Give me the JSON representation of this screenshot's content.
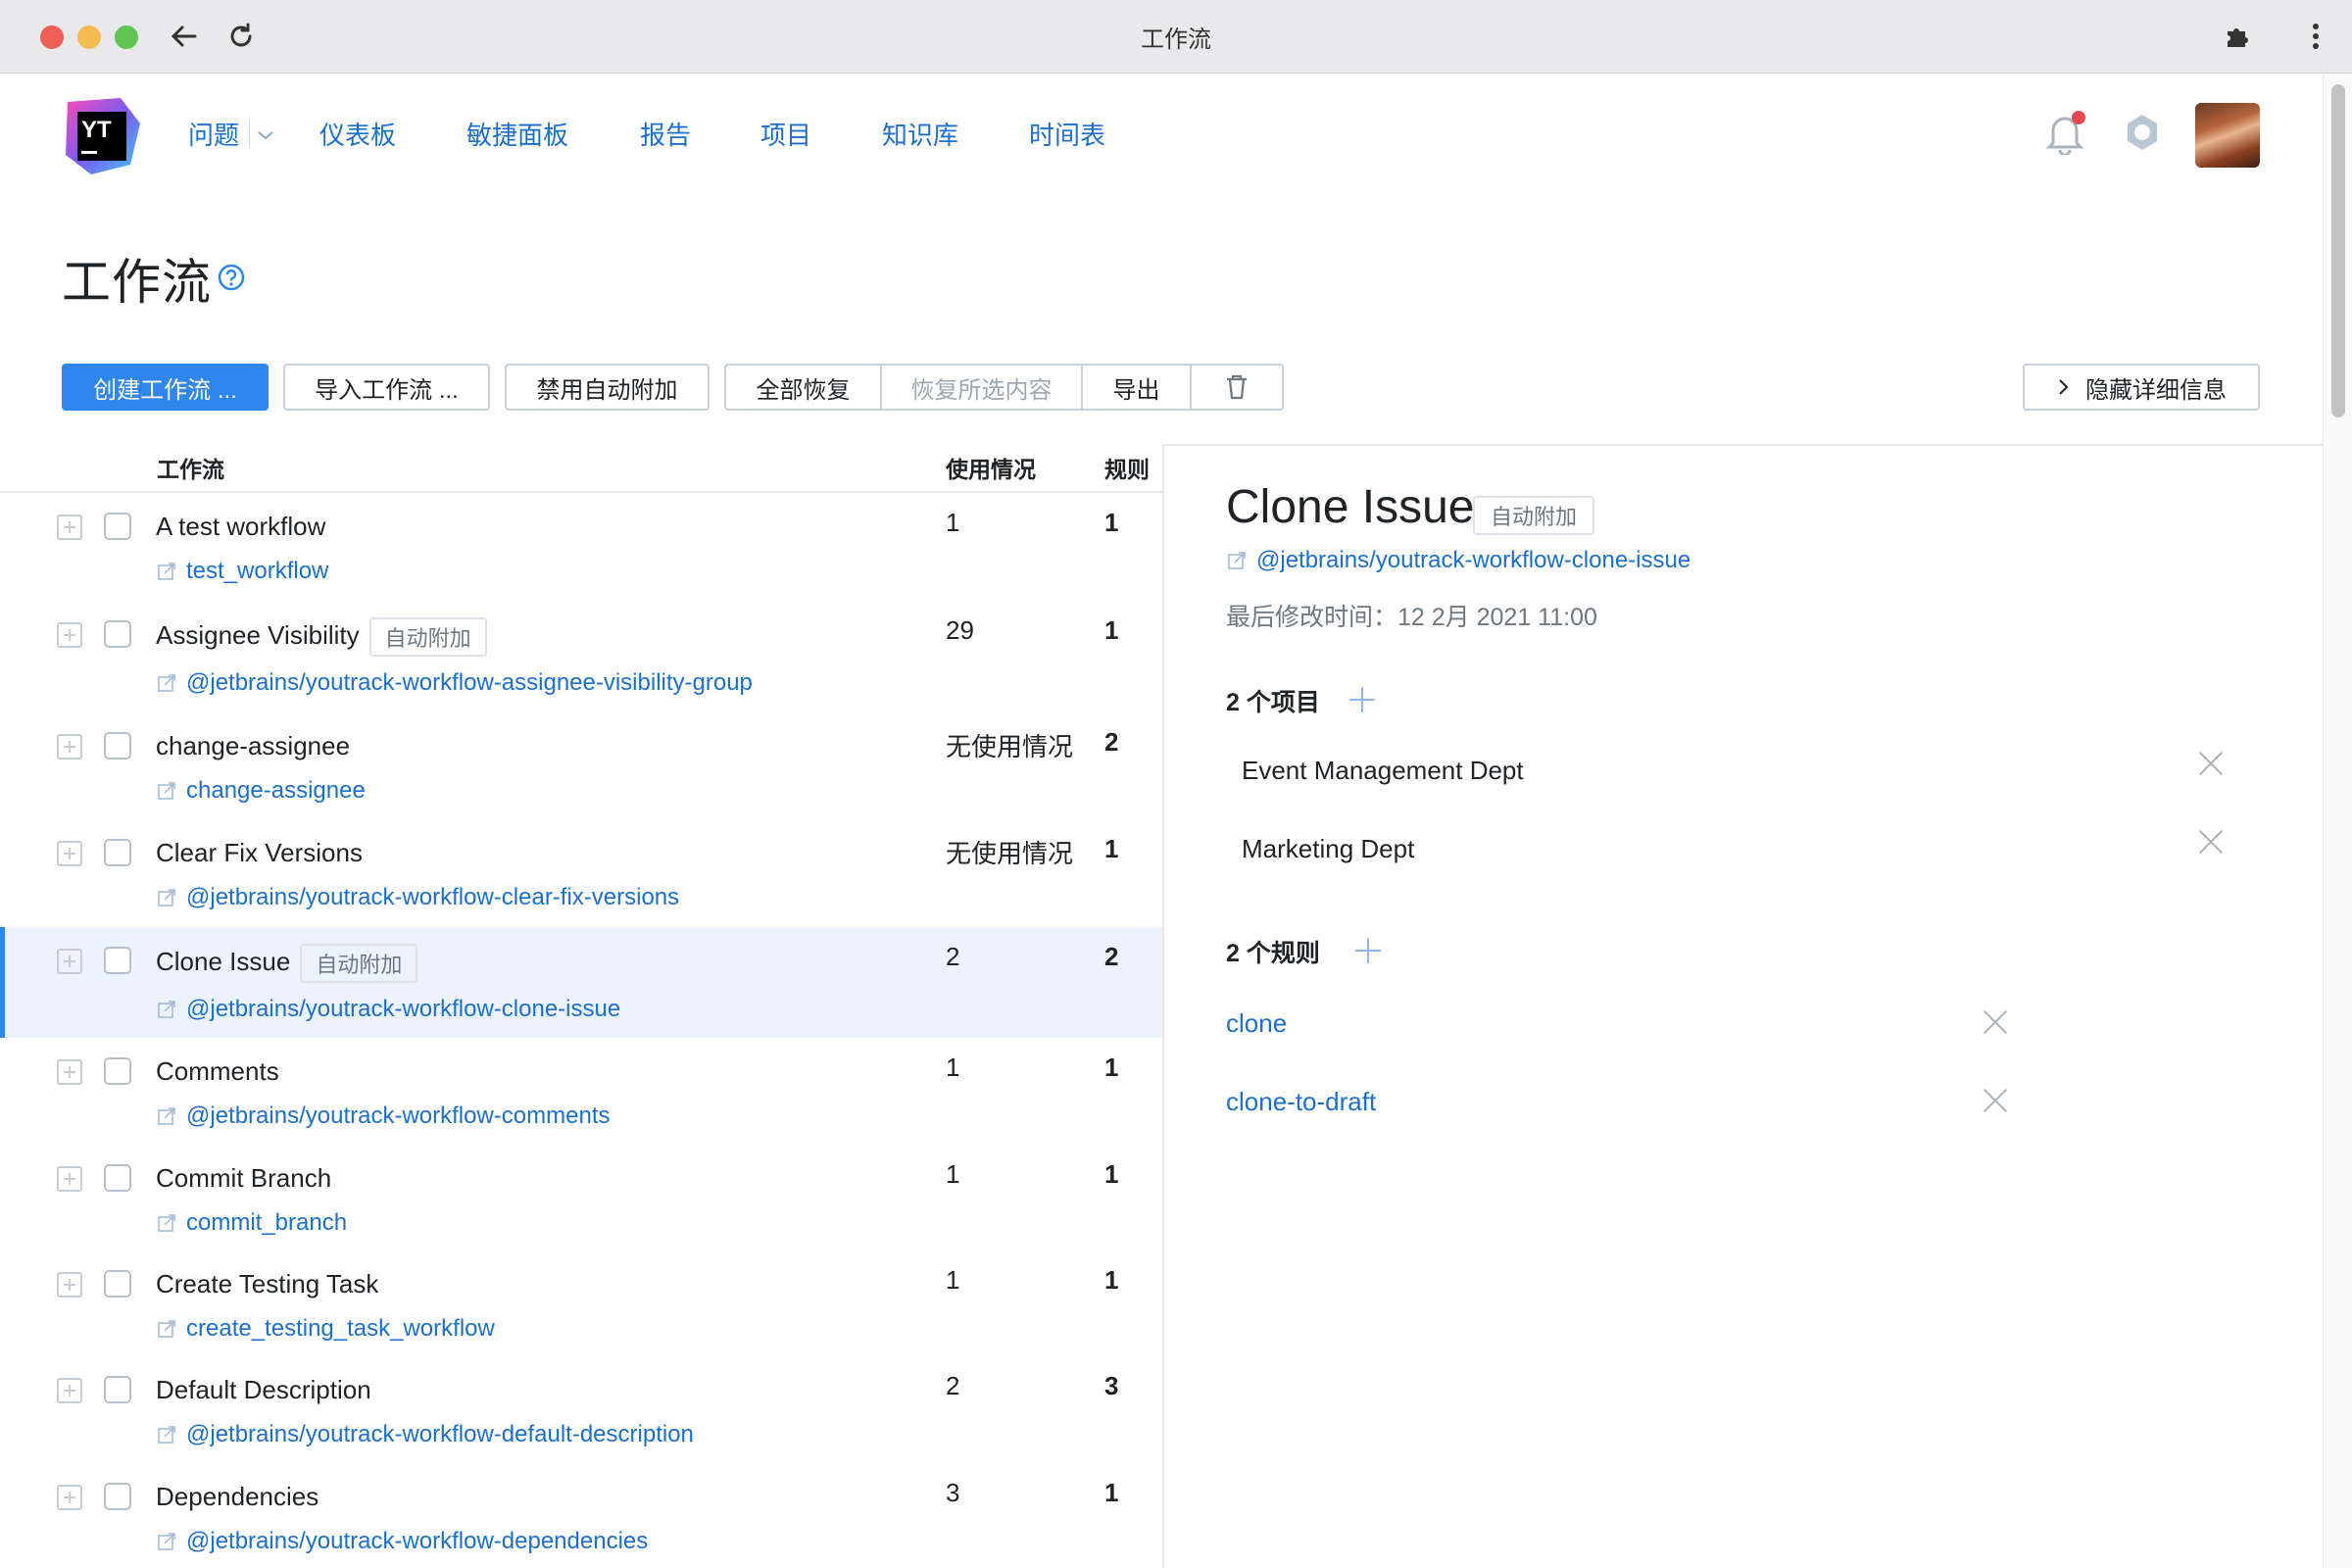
{
  "browser": {
    "title": "工作流"
  },
  "nav": {
    "items": [
      "问题",
      "仪表板",
      "敏捷面板",
      "报告",
      "项目",
      "知识库",
      "时间表"
    ],
    "logo_text": "YT"
  },
  "page": {
    "title": "工作流"
  },
  "toolbar": {
    "create": "创建工作流 ...",
    "import": "导入工作流 ...",
    "disable_autoattach": "禁用自动附加",
    "restore_all": "全部恢复",
    "restore_selected": "恢复所选内容",
    "export": "导出",
    "hide_details": "隐藏详细信息"
  },
  "list": {
    "headers": {
      "workflow": "工作流",
      "usage": "使用情况",
      "rules": "规则"
    },
    "rows": [
      {
        "name": "A test workflow",
        "tag": "",
        "package": "test_workflow",
        "usage": "1",
        "rules": "1"
      },
      {
        "name": "Assignee Visibility",
        "tag": "自动附加",
        "package": "@jetbrains/youtrack-workflow-assignee-visibility-group",
        "usage": "29",
        "rules": "1"
      },
      {
        "name": "change-assignee",
        "tag": "",
        "package": "change-assignee",
        "usage": "无使用情况",
        "rules": "2"
      },
      {
        "name": "Clear Fix Versions",
        "tag": "",
        "package": "@jetbrains/youtrack-workflow-clear-fix-versions",
        "usage": "无使用情况",
        "rules": "1"
      },
      {
        "name": "Clone Issue",
        "tag": "自动附加",
        "package": "@jetbrains/youtrack-workflow-clone-issue",
        "usage": "2",
        "rules": "2"
      },
      {
        "name": "Comments",
        "tag": "",
        "package": "@jetbrains/youtrack-workflow-comments",
        "usage": "1",
        "rules": "1"
      },
      {
        "name": "Commit Branch",
        "tag": "",
        "package": "commit_branch",
        "usage": "1",
        "rules": "1"
      },
      {
        "name": "Create Testing Task",
        "tag": "",
        "package": "create_testing_task_workflow",
        "usage": "1",
        "rules": "1"
      },
      {
        "name": "Default Description",
        "tag": "",
        "package": "@jetbrains/youtrack-workflow-default-description",
        "usage": "2",
        "rules": "3"
      },
      {
        "name": "Dependencies",
        "tag": "",
        "package": "@jetbrains/youtrack-workflow-dependencies",
        "usage": "3",
        "rules": "1"
      }
    ]
  },
  "details": {
    "title": "Clone Issue",
    "tag": "自动附加",
    "package": "@jetbrains/youtrack-workflow-clone-issue",
    "modified": "最后修改时间：12 2月 2021 11:00",
    "projects_heading": "2 个项目",
    "projects": [
      "Event Management Dept",
      "Marketing Dept"
    ],
    "rules_heading": "2 个规则",
    "rules": [
      "clone",
      "clone-to-draft"
    ]
  }
}
